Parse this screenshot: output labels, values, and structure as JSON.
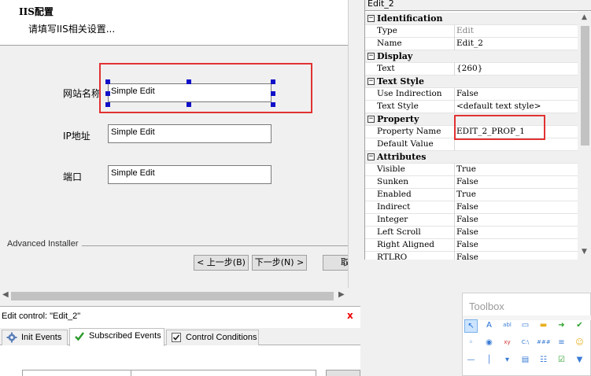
{
  "designer": {
    "dialog_title": "IIS配置",
    "dialog_subtitle": "请填写IIS相关设置...",
    "fields": [
      {
        "label": "网站名称",
        "value": "Simple Edit"
      },
      {
        "label": "IP地址",
        "value": "Simple Edit"
      },
      {
        "label": "端口",
        "value": "Simple Edit"
      }
    ],
    "brand": "Advanced Installer",
    "buttons": {
      "back": "< 上一步(B)",
      "next": "下一步(N) >",
      "cancel": "取"
    }
  },
  "bottom": {
    "edit_control_label": "Edit control: \"Edit_2\"",
    "close_glyph": "x",
    "tabs": [
      {
        "label": "Init Events",
        "icon": "gear-icon"
      },
      {
        "label": "Subscribed Events",
        "icon": "checkmark-icon"
      },
      {
        "label": "Control Conditions",
        "icon": "checkbox-icon"
      }
    ]
  },
  "properties": {
    "object_name": "Edit_2",
    "categories": [
      {
        "name": "Identification",
        "rows": [
          {
            "name": "Type",
            "value": "Edit",
            "muted": true
          },
          {
            "name": "Name",
            "value": "Edit_2"
          }
        ]
      },
      {
        "name": "Display",
        "rows": [
          {
            "name": "Text",
            "value": "{260}"
          }
        ]
      },
      {
        "name": "Text Style",
        "rows": [
          {
            "name": "Use Indirection",
            "value": "False"
          },
          {
            "name": "Text Style",
            "value": "<default text style>"
          }
        ]
      },
      {
        "name": "Property",
        "rows": [
          {
            "name": "Property Name",
            "value": "EDIT_2_PROP_1"
          },
          {
            "name": "Default Value",
            "value": ""
          }
        ]
      },
      {
        "name": "Attributes",
        "rows": [
          {
            "name": "Visible",
            "value": "True"
          },
          {
            "name": "Sunken",
            "value": "False"
          },
          {
            "name": "Enabled",
            "value": "True"
          },
          {
            "name": "Indirect",
            "value": "False"
          },
          {
            "name": "Integer",
            "value": "False"
          },
          {
            "name": "Left Scroll",
            "value": "False"
          },
          {
            "name": "Right Aligned",
            "value": "False"
          },
          {
            "name": "RTLRO",
            "value": "False"
          }
        ]
      }
    ]
  },
  "toolbox": {
    "title": "Toolbox",
    "tools": [
      {
        "icon": "pointer-icon",
        "glyph": "↖"
      },
      {
        "icon": "text-icon",
        "glyph": "A"
      },
      {
        "icon": "edit-box-icon",
        "glyph": "abl"
      },
      {
        "icon": "panel-icon",
        "glyph": "▭"
      },
      {
        "icon": "group-box-icon",
        "glyph": "▬"
      },
      {
        "icon": "push-button-icon",
        "glyph": "➜"
      },
      {
        "icon": "checkbox-tool-icon",
        "glyph": "✔"
      },
      {
        "icon": "radio-icon",
        "glyph": "◦"
      },
      {
        "icon": "radio-group-icon",
        "glyph": "◉"
      },
      {
        "icon": "xy-icon",
        "glyph": "xy"
      },
      {
        "icon": "path-edit-icon",
        "glyph": "C:\\"
      },
      {
        "icon": "masked-edit-icon",
        "glyph": "###"
      },
      {
        "icon": "list-icon",
        "glyph": "≡"
      },
      {
        "icon": "smiley-icon",
        "glyph": "☺"
      },
      {
        "icon": "line-icon",
        "glyph": "—"
      },
      {
        "icon": "vline-icon",
        "glyph": "│"
      },
      {
        "icon": "combo-icon",
        "glyph": "▾"
      },
      {
        "icon": "listbox-icon",
        "glyph": "▤"
      },
      {
        "icon": "tree-icon",
        "glyph": "☷"
      },
      {
        "icon": "checklist-icon",
        "glyph": "☑"
      },
      {
        "icon": "dropdown-icon",
        "glyph": "▼"
      }
    ]
  },
  "colors": {
    "selection_box": "#e23232",
    "handle": "#1010c8"
  }
}
